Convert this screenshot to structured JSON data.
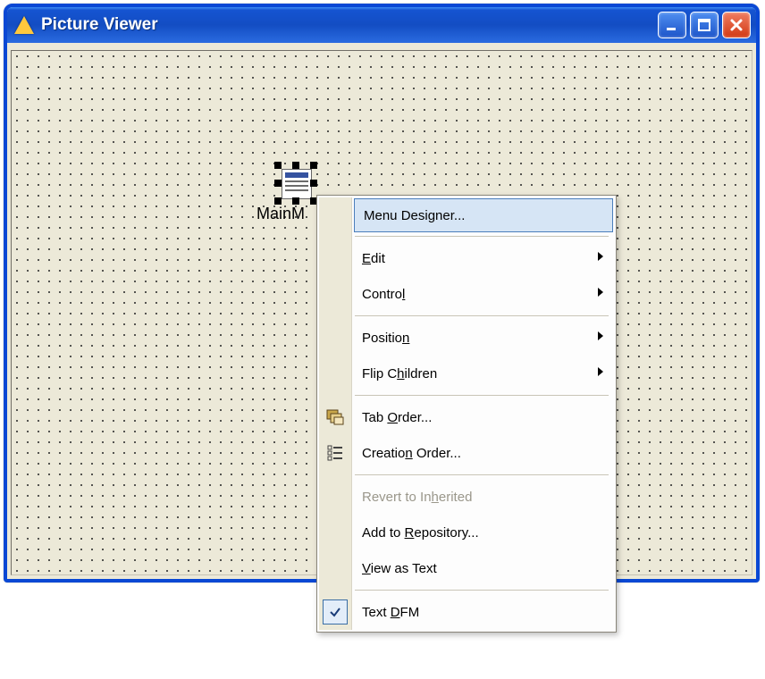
{
  "window": {
    "title": "Picture Viewer"
  },
  "designer": {
    "component_label": "MainM",
    "context_menu": {
      "items": [
        {
          "label_html": "Menu Desi<u>g</u>ner...",
          "highlight": true,
          "arrow": false,
          "separator_after": true
        },
        {
          "label_html": "<u>E</u>dit",
          "arrow": true
        },
        {
          "label_html": "Contro<u>l</u>",
          "arrow": true,
          "separator_after": true
        },
        {
          "label_html": "Positio<u>n</u>",
          "arrow": true
        },
        {
          "label_html": "Flip C<u>h</u>ildren",
          "arrow": true,
          "separator_after": true
        },
        {
          "label_html": "Tab <u>O</u>rder...",
          "arrow": false,
          "icon": "tab-order-icon"
        },
        {
          "label_html": "Creatio<u>n</u> Order...",
          "arrow": false,
          "icon": "creation-order-icon",
          "separator_after": true
        },
        {
          "label_html": "Revert to In<u>h</u>erited",
          "arrow": false,
          "disabled": true
        },
        {
          "label_html": "Add to <u>R</u>epository...",
          "arrow": false
        },
        {
          "label_html": "<u>V</u>iew as Text",
          "arrow": false,
          "separator_after": true
        },
        {
          "label_html": "Text <u>D</u>FM",
          "arrow": false,
          "checked": true
        }
      ]
    }
  }
}
